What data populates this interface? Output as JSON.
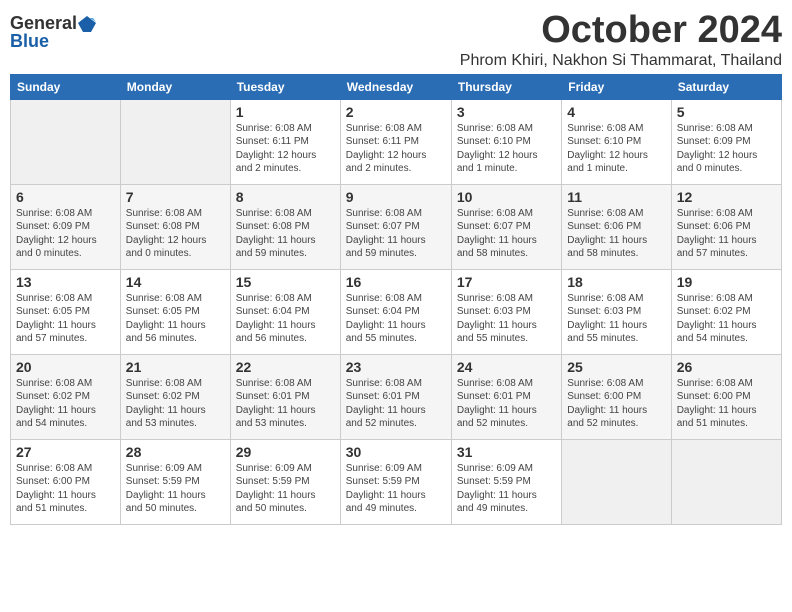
{
  "header": {
    "logo_general": "General",
    "logo_blue": "Blue",
    "title": "October 2024",
    "subtitle": "Phrom Khiri, Nakhon Si Thammarat, Thailand"
  },
  "calendar": {
    "days_of_week": [
      "Sunday",
      "Monday",
      "Tuesday",
      "Wednesday",
      "Thursday",
      "Friday",
      "Saturday"
    ],
    "weeks": [
      [
        {
          "day": "",
          "info": ""
        },
        {
          "day": "",
          "info": ""
        },
        {
          "day": "1",
          "info": "Sunrise: 6:08 AM\nSunset: 6:11 PM\nDaylight: 12 hours\nand 2 minutes."
        },
        {
          "day": "2",
          "info": "Sunrise: 6:08 AM\nSunset: 6:11 PM\nDaylight: 12 hours\nand 2 minutes."
        },
        {
          "day": "3",
          "info": "Sunrise: 6:08 AM\nSunset: 6:10 PM\nDaylight: 12 hours\nand 1 minute."
        },
        {
          "day": "4",
          "info": "Sunrise: 6:08 AM\nSunset: 6:10 PM\nDaylight: 12 hours\nand 1 minute."
        },
        {
          "day": "5",
          "info": "Sunrise: 6:08 AM\nSunset: 6:09 PM\nDaylight: 12 hours\nand 0 minutes."
        }
      ],
      [
        {
          "day": "6",
          "info": "Sunrise: 6:08 AM\nSunset: 6:09 PM\nDaylight: 12 hours\nand 0 minutes."
        },
        {
          "day": "7",
          "info": "Sunrise: 6:08 AM\nSunset: 6:08 PM\nDaylight: 12 hours\nand 0 minutes."
        },
        {
          "day": "8",
          "info": "Sunrise: 6:08 AM\nSunset: 6:08 PM\nDaylight: 11 hours\nand 59 minutes."
        },
        {
          "day": "9",
          "info": "Sunrise: 6:08 AM\nSunset: 6:07 PM\nDaylight: 11 hours\nand 59 minutes."
        },
        {
          "day": "10",
          "info": "Sunrise: 6:08 AM\nSunset: 6:07 PM\nDaylight: 11 hours\nand 58 minutes."
        },
        {
          "day": "11",
          "info": "Sunrise: 6:08 AM\nSunset: 6:06 PM\nDaylight: 11 hours\nand 58 minutes."
        },
        {
          "day": "12",
          "info": "Sunrise: 6:08 AM\nSunset: 6:06 PM\nDaylight: 11 hours\nand 57 minutes."
        }
      ],
      [
        {
          "day": "13",
          "info": "Sunrise: 6:08 AM\nSunset: 6:05 PM\nDaylight: 11 hours\nand 57 minutes."
        },
        {
          "day": "14",
          "info": "Sunrise: 6:08 AM\nSunset: 6:05 PM\nDaylight: 11 hours\nand 56 minutes."
        },
        {
          "day": "15",
          "info": "Sunrise: 6:08 AM\nSunset: 6:04 PM\nDaylight: 11 hours\nand 56 minutes."
        },
        {
          "day": "16",
          "info": "Sunrise: 6:08 AM\nSunset: 6:04 PM\nDaylight: 11 hours\nand 55 minutes."
        },
        {
          "day": "17",
          "info": "Sunrise: 6:08 AM\nSunset: 6:03 PM\nDaylight: 11 hours\nand 55 minutes."
        },
        {
          "day": "18",
          "info": "Sunrise: 6:08 AM\nSunset: 6:03 PM\nDaylight: 11 hours\nand 55 minutes."
        },
        {
          "day": "19",
          "info": "Sunrise: 6:08 AM\nSunset: 6:02 PM\nDaylight: 11 hours\nand 54 minutes."
        }
      ],
      [
        {
          "day": "20",
          "info": "Sunrise: 6:08 AM\nSunset: 6:02 PM\nDaylight: 11 hours\nand 54 minutes."
        },
        {
          "day": "21",
          "info": "Sunrise: 6:08 AM\nSunset: 6:02 PM\nDaylight: 11 hours\nand 53 minutes."
        },
        {
          "day": "22",
          "info": "Sunrise: 6:08 AM\nSunset: 6:01 PM\nDaylight: 11 hours\nand 53 minutes."
        },
        {
          "day": "23",
          "info": "Sunrise: 6:08 AM\nSunset: 6:01 PM\nDaylight: 11 hours\nand 52 minutes."
        },
        {
          "day": "24",
          "info": "Sunrise: 6:08 AM\nSunset: 6:01 PM\nDaylight: 11 hours\nand 52 minutes."
        },
        {
          "day": "25",
          "info": "Sunrise: 6:08 AM\nSunset: 6:00 PM\nDaylight: 11 hours\nand 52 minutes."
        },
        {
          "day": "26",
          "info": "Sunrise: 6:08 AM\nSunset: 6:00 PM\nDaylight: 11 hours\nand 51 minutes."
        }
      ],
      [
        {
          "day": "27",
          "info": "Sunrise: 6:08 AM\nSunset: 6:00 PM\nDaylight: 11 hours\nand 51 minutes."
        },
        {
          "day": "28",
          "info": "Sunrise: 6:09 AM\nSunset: 5:59 PM\nDaylight: 11 hours\nand 50 minutes."
        },
        {
          "day": "29",
          "info": "Sunrise: 6:09 AM\nSunset: 5:59 PM\nDaylight: 11 hours\nand 50 minutes."
        },
        {
          "day": "30",
          "info": "Sunrise: 6:09 AM\nSunset: 5:59 PM\nDaylight: 11 hours\nand 49 minutes."
        },
        {
          "day": "31",
          "info": "Sunrise: 6:09 AM\nSunset: 5:59 PM\nDaylight: 11 hours\nand 49 minutes."
        },
        {
          "day": "",
          "info": ""
        },
        {
          "day": "",
          "info": ""
        }
      ]
    ]
  }
}
